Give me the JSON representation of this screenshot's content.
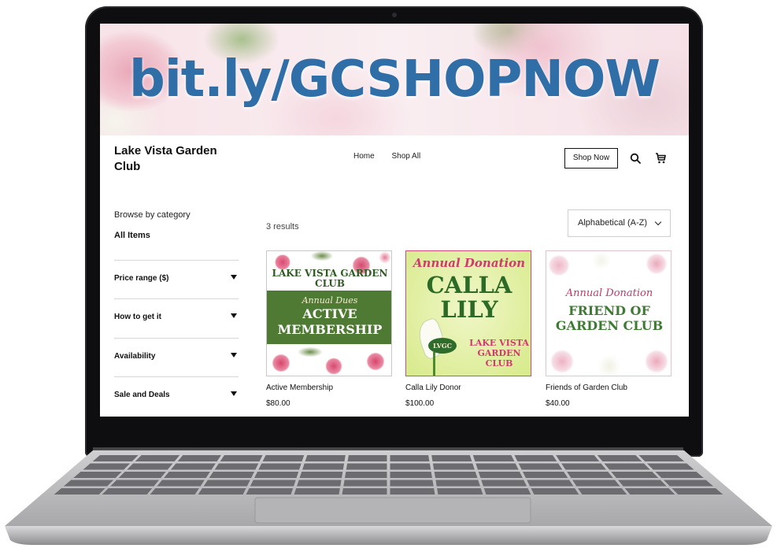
{
  "banner": {
    "url_text": "bit.ly/GCSHOPNOW"
  },
  "header": {
    "site_name": "Lake Vista Garden Club",
    "nav": [
      "Home",
      "Shop All"
    ],
    "shop_now_label": "Shop Now"
  },
  "sidebar": {
    "browse_label": "Browse by category",
    "category": "All Items",
    "filters": [
      "Price range ($)",
      "How to get it",
      "Availability",
      "Sale and Deals"
    ]
  },
  "results": {
    "count_label": "3 results",
    "sort_label": "Alphabetical (A-Z)"
  },
  "products": [
    {
      "name": "Active Membership",
      "price": "$80.00",
      "art": {
        "club": "LAKE VISTA GARDEN CLUB",
        "script": "Annual Dues",
        "title_line1": "ACTIVE",
        "title_line2": "MEMBERSHIP"
      }
    },
    {
      "name": "Calla Lily Donor",
      "price": "$100.00",
      "art": {
        "script": "Annual Donation",
        "title_line1": "CALLA",
        "title_line2": "LILY",
        "badge": "LVGC",
        "club_line1": "LAKE VISTA",
        "club_line2": "GARDEN",
        "club_line3": "CLUB"
      }
    },
    {
      "name": "Friends of Garden Club",
      "price": "$40.00",
      "art": {
        "script": "Annual Donation",
        "title_line1": "FRIEND OF",
        "title_line2": "GARDEN CLUB"
      }
    }
  ],
  "colors": {
    "banner_text": "#2f6ea6",
    "green_band": "#4e7a34",
    "pink_accent": "#d13a6e",
    "laptop_bezel": "#0e0e10"
  },
  "icons": [
    "search-icon",
    "cart-icon",
    "chevron-down-icon",
    "caret-down-icon",
    "camera-icon"
  ]
}
